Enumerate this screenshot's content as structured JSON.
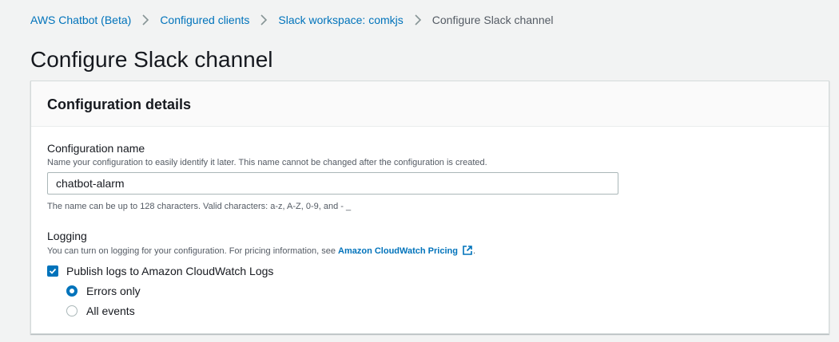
{
  "breadcrumb": {
    "items": [
      {
        "label": "AWS Chatbot (Beta)"
      },
      {
        "label": "Configured clients"
      },
      {
        "label": "Slack workspace: comkjs"
      },
      {
        "label": "Configure Slack channel"
      }
    ]
  },
  "page": {
    "title": "Configure Slack channel"
  },
  "panel": {
    "title": "Configuration details"
  },
  "config_name": {
    "label": "Configuration name",
    "description": "Name your configuration to easily identify it later. This name cannot be changed after the configuration is created.",
    "value": "chatbot-alarm",
    "constraint": "The name can be up to 128 characters. Valid characters: a-z, A-Z, 0-9, and - _"
  },
  "logging": {
    "label": "Logging",
    "description_prefix": "You can turn on logging for your configuration. For pricing information, see ",
    "pricing_link": "Amazon CloudWatch Pricing",
    "description_suffix": ".",
    "publish_label": "Publish logs to Amazon CloudWatch Logs",
    "publish_checked": true,
    "options": [
      {
        "label": "Errors only",
        "selected": true
      },
      {
        "label": "All events",
        "selected": false
      }
    ]
  },
  "icons": {
    "separator": "chevron-right-icon",
    "external": "external-link-icon",
    "check": "checkmark-icon"
  },
  "colors": {
    "link": "#0073bb",
    "background": "#f2f3f3",
    "text": "#16191f",
    "secondary_text": "#545b64"
  }
}
